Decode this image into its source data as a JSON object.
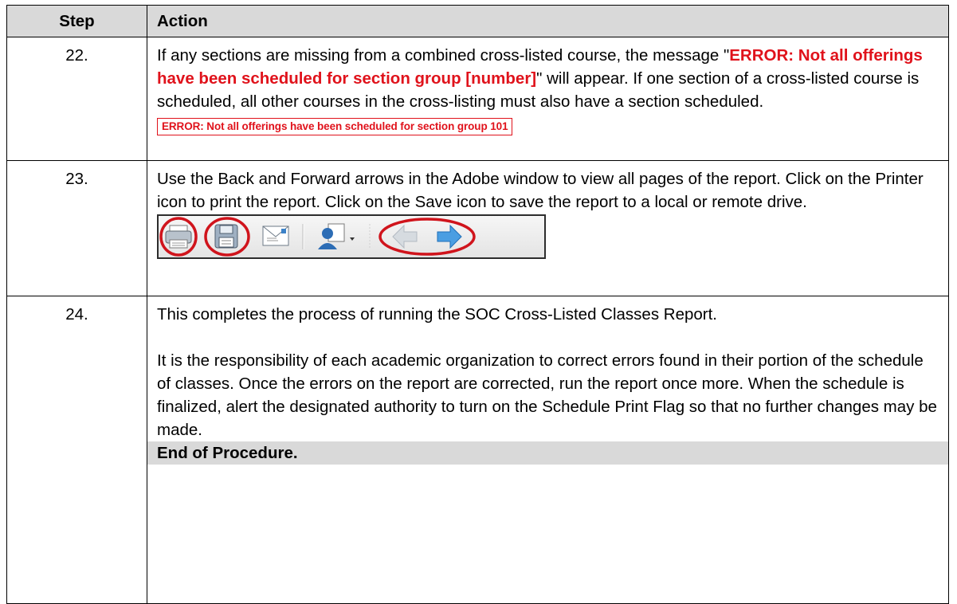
{
  "table": {
    "header": {
      "step": "Step",
      "action": "Action"
    },
    "rows": [
      {
        "step": "22.",
        "text_before": "If any sections are missing from a combined cross-listed course, the message \"",
        "error_text": "ERROR: Not all offerings have been scheduled for section group [number]",
        "text_after": "\" will appear.  If one section of a cross-listed course is scheduled, all other courses in the cross-listing must also have a section scheduled.",
        "error_image_text": "ERROR:  Not all offerings have been scheduled for section group 101"
      },
      {
        "step": "23.",
        "text": "Use the Back and Forward arrows in the Adobe window to view all pages of the report.  Click on the Printer icon to print the report.  Click on the Save icon to save the report to a local or remote drive.",
        "toolbar_icons": [
          "printer-icon",
          "save-icon",
          "email-icon",
          "user-share-icon",
          "back-arrow-icon",
          "forward-arrow-icon"
        ]
      },
      {
        "step": "24.",
        "para1": "This completes the process of running the SOC Cross-Listed Classes Report.",
        "para2": "It is the responsibility of each academic organization to correct errors found in their portion of the schedule of classes.  Once the errors on the report are corrected, run the report once more.  When the schedule is finalized, alert the designated authority to turn on the Schedule Print Flag so that no further changes may be made.",
        "end": "End of Procedure."
      }
    ]
  },
  "colors": {
    "header_bg": "#d9d9d9",
    "error_red": "#e0121b",
    "highlight_red": "#d0141c"
  }
}
